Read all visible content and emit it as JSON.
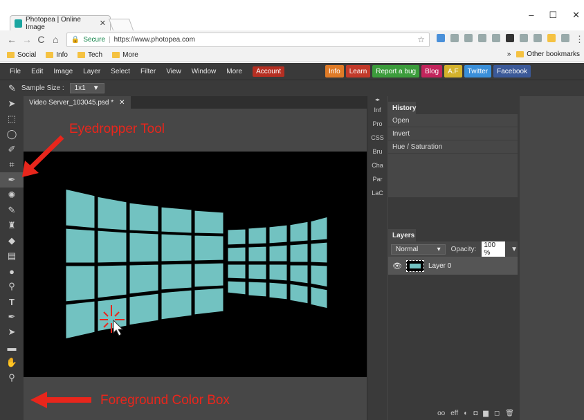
{
  "browser": {
    "tab_title": "Photopea | Online Image",
    "tab_close": "✕",
    "window_controls": [
      "–",
      "☐",
      "✕"
    ],
    "nav": {
      "back": "←",
      "forward": "→",
      "reload": "C",
      "home": "⌂"
    },
    "secure_label": "Secure",
    "url": "https://www.photopea.com",
    "bookmarks": [
      "Social",
      "Info",
      "Tech",
      "More"
    ],
    "bookmarks_overflow": "»",
    "other_bookmarks": "Other bookmarks"
  },
  "app": {
    "menu": [
      "File",
      "Edit",
      "Image",
      "Layer",
      "Select",
      "Filter",
      "View",
      "Window",
      "More"
    ],
    "account_label": "Account",
    "link_buttons": [
      {
        "label": "Info",
        "color": "#e07b27"
      },
      {
        "label": "Learn",
        "color": "#c23a2a"
      },
      {
        "label": "Report a bug",
        "color": "#3c9c3c"
      },
      {
        "label": "Blog",
        "color": "#c2255c"
      },
      {
        "label": "A.F",
        "color": "#d4b22c"
      },
      {
        "label": "Twitter",
        "color": "#3a8fd9"
      },
      {
        "label": "Facebook",
        "color": "#3b5998"
      }
    ],
    "options": {
      "sample_size_label": "Sample Size :",
      "sample_size_value": "1x1",
      "dropdown_arrow": "▼"
    },
    "document": {
      "tab_name": "Video Server_103045.psd *",
      "close": "✕"
    },
    "side_strip": [
      "Inf",
      "Pro",
      "CSS",
      "Bru",
      "Cha",
      "Par",
      "LaC"
    ],
    "history": {
      "title": "History",
      "items": [
        "Open",
        "Invert",
        "Hue / Saturation"
      ]
    },
    "layers": {
      "title": "Layers",
      "blend_mode": "Normal",
      "opacity_label": "Opacity:",
      "opacity_value": "100 %",
      "layer_name": "Layer 0",
      "footer_icons": [
        "oo",
        "eff",
        "◐",
        "◘",
        "▆",
        "◻",
        "🗑"
      ]
    },
    "foreground_color": "#72c2c1"
  },
  "annotations": {
    "eyedropper": "Eyedropper Tool",
    "foreground": "Foreground Color Box"
  }
}
